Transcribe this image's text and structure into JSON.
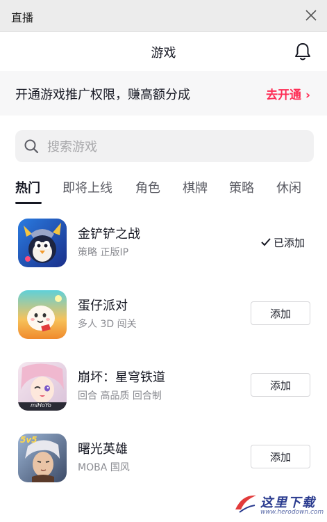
{
  "window": {
    "title": "直播",
    "close_icon": "close-icon"
  },
  "header": {
    "title": "游戏",
    "bell_icon": "bell-icon"
  },
  "promo": {
    "text": "开通游戏推广权限，赚高额分成",
    "cta": "去开通 ›",
    "cta_color": "#fe2c55"
  },
  "search": {
    "placeholder": "搜索游戏",
    "value": ""
  },
  "tabs": [
    {
      "label": "热门",
      "active": true
    },
    {
      "label": "即将上线",
      "active": false
    },
    {
      "label": "角色",
      "active": false
    },
    {
      "label": "棋牌",
      "active": false
    },
    {
      "label": "策略",
      "active": false
    },
    {
      "label": "休闲",
      "active": false
    }
  ],
  "games": [
    {
      "name": "金铲铲之战",
      "tags": "策略 正版IP",
      "added": true,
      "status_label": "已添加"
    },
    {
      "name": "蛋仔派对",
      "tags": "多人 3D 闯关",
      "added": false,
      "button_label": "添加"
    },
    {
      "name": "崩坏：星穹铁道",
      "tags": "回合 高品质 回合制",
      "added": false,
      "button_label": "添加"
    },
    {
      "name": "曙光英雄",
      "tags": "MOBA 国风",
      "added": false,
      "button_label": "添加"
    }
  ],
  "icon_badges": {
    "honkai": "miHoYo",
    "shuguang": "5v5"
  },
  "watermark": {
    "text": "这里下载",
    "url": "www.herodown.com"
  }
}
